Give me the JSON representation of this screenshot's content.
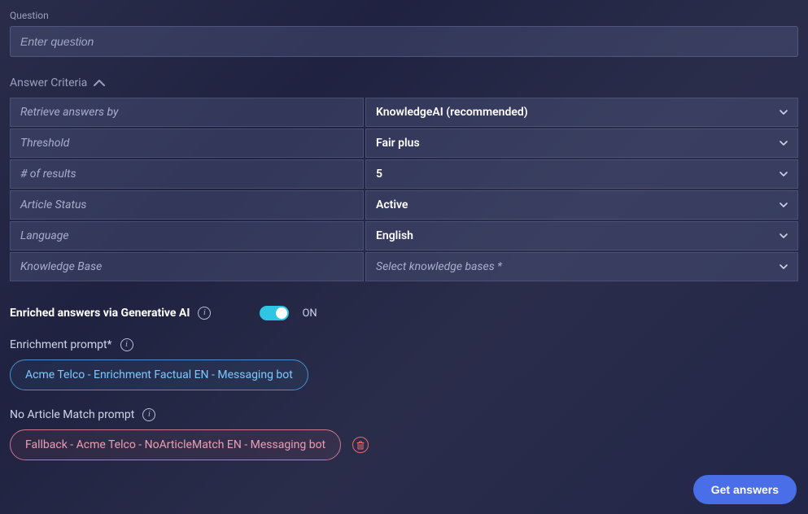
{
  "question": {
    "label": "Question",
    "placeholder": "Enter question",
    "value": ""
  },
  "answerCriteria": {
    "title": "Answer Criteria",
    "rows": [
      {
        "label": "Retrieve answers by",
        "value": "KnowledgeAI (recommended)",
        "placeholder": false
      },
      {
        "label": "Threshold",
        "value": "Fair plus",
        "placeholder": false
      },
      {
        "label": "# of results",
        "value": "5",
        "placeholder": false
      },
      {
        "label": "Article Status",
        "value": "Active",
        "placeholder": false
      },
      {
        "label": "Language",
        "value": "English",
        "placeholder": false
      },
      {
        "label": "Knowledge Base",
        "value": "Select knowledge bases *",
        "placeholder": true
      }
    ]
  },
  "enriched": {
    "label": "Enriched answers via Generative AI",
    "state": "ON"
  },
  "enrichmentPrompt": {
    "label": "Enrichment prompt*",
    "chip": "Acme Telco - Enrichment Factual EN - Messaging bot"
  },
  "noArticleMatch": {
    "label": "No Article Match prompt",
    "chip": "Fallback - Acme Telco - NoArticleMatch EN - Messaging bot"
  },
  "footer": {
    "getAnswers": "Get answers"
  }
}
